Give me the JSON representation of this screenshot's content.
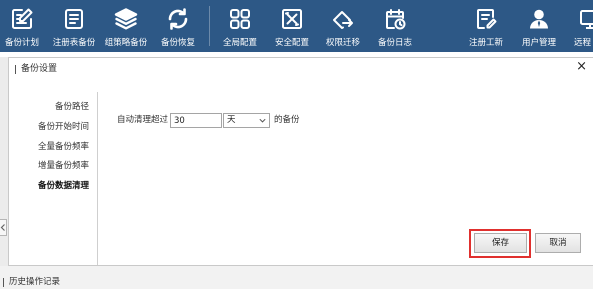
{
  "colors": {
    "toolbar_bg": "#2d5886",
    "toolbar_text": "#ffffff",
    "highlight": "#e0302e",
    "dialog_bg": "#ffffff",
    "border": "#c9c9c9"
  },
  "toolbar": {
    "items": [
      {
        "label": "备份计划",
        "icon": "edit-document-icon"
      },
      {
        "label": "注册表备份",
        "icon": "list-document-icon"
      },
      {
        "label": "组策略备份",
        "icon": "layers-icon"
      },
      {
        "label": "备份恢复",
        "icon": "restore-icon"
      },
      {
        "label": "全局配置",
        "icon": "grid-icon"
      },
      {
        "label": "安全配置",
        "icon": "tools-icon"
      },
      {
        "label": "权限迁移",
        "icon": "migrate-icon"
      },
      {
        "label": "备份日志",
        "icon": "calendar-clock-icon"
      },
      {
        "label": "注册工新",
        "icon": "edit-document-icon"
      },
      {
        "label": "用户管理",
        "icon": "user-icon"
      },
      {
        "label": "远程",
        "icon": "monitor-icon"
      }
    ]
  },
  "dialog": {
    "title": "备份设置",
    "close_glyph": "×",
    "nav": [
      {
        "label": "备份路径",
        "active": false
      },
      {
        "label": "备份开始时间",
        "active": false
      },
      {
        "label": "全量备份频率",
        "active": false
      },
      {
        "label": "增量备份频率",
        "active": false
      },
      {
        "label": "备份数据清理",
        "active": true
      }
    ],
    "cleanup": {
      "prefix": "自动清理超过",
      "days_value": "30",
      "unit_selected": "天",
      "suffix": "的备份"
    },
    "buttons": {
      "save": "保存",
      "cancel": "取消",
      "save_highlighted": true
    }
  },
  "footer": {
    "history_label": "历史操作记录"
  }
}
